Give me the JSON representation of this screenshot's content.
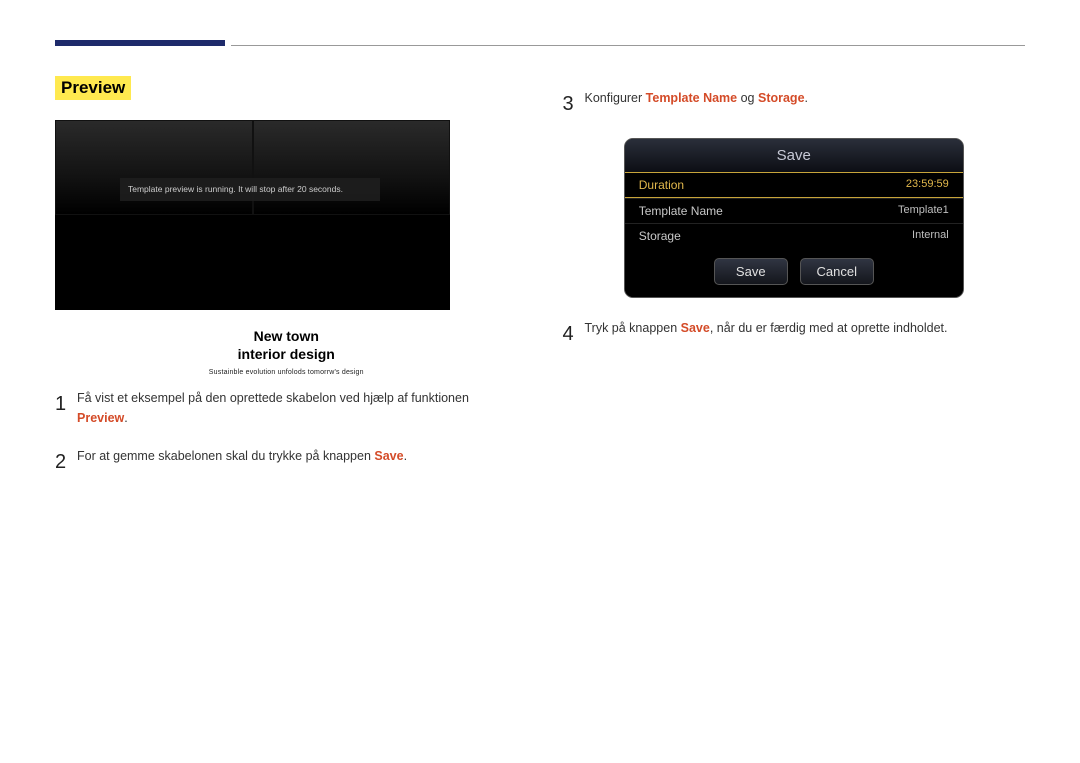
{
  "section_title": "Preview",
  "preview": {
    "running_msg": "Template preview is running. It will stop after 20 seconds.",
    "headline_1": "New town",
    "headline_2": "interior design",
    "tagline": "Sustainble evolution unfolods tomorrw's design"
  },
  "left_steps": {
    "s1": {
      "num": "1",
      "pre": "Få vist et eksempel på den oprettede skabelon ved hjælp af funktionen ",
      "kw": "Preview",
      "post": "."
    },
    "s2": {
      "num": "2",
      "pre": "For at gemme skabelonen skal du trykke på knappen ",
      "kw": "Save",
      "post": "."
    }
  },
  "right_steps": {
    "s3": {
      "num": "3",
      "pre": "Konfigurer ",
      "bold1": "Template Name",
      "mid": " og ",
      "bold2": "Storage",
      "post": "."
    },
    "s4": {
      "num": "4",
      "pre": "Tryk på knappen ",
      "kw": "Save",
      "post": ", når du er færdig med at oprette indholdet."
    }
  },
  "dialog": {
    "title": "Save",
    "rows": {
      "duration_label": "Duration",
      "duration_value": "23:59:59",
      "tpl_label": "Template Name",
      "tpl_value": "Template1",
      "storage_label": "Storage",
      "storage_value": "Internal"
    },
    "save_btn": "Save",
    "cancel_btn": "Cancel"
  }
}
